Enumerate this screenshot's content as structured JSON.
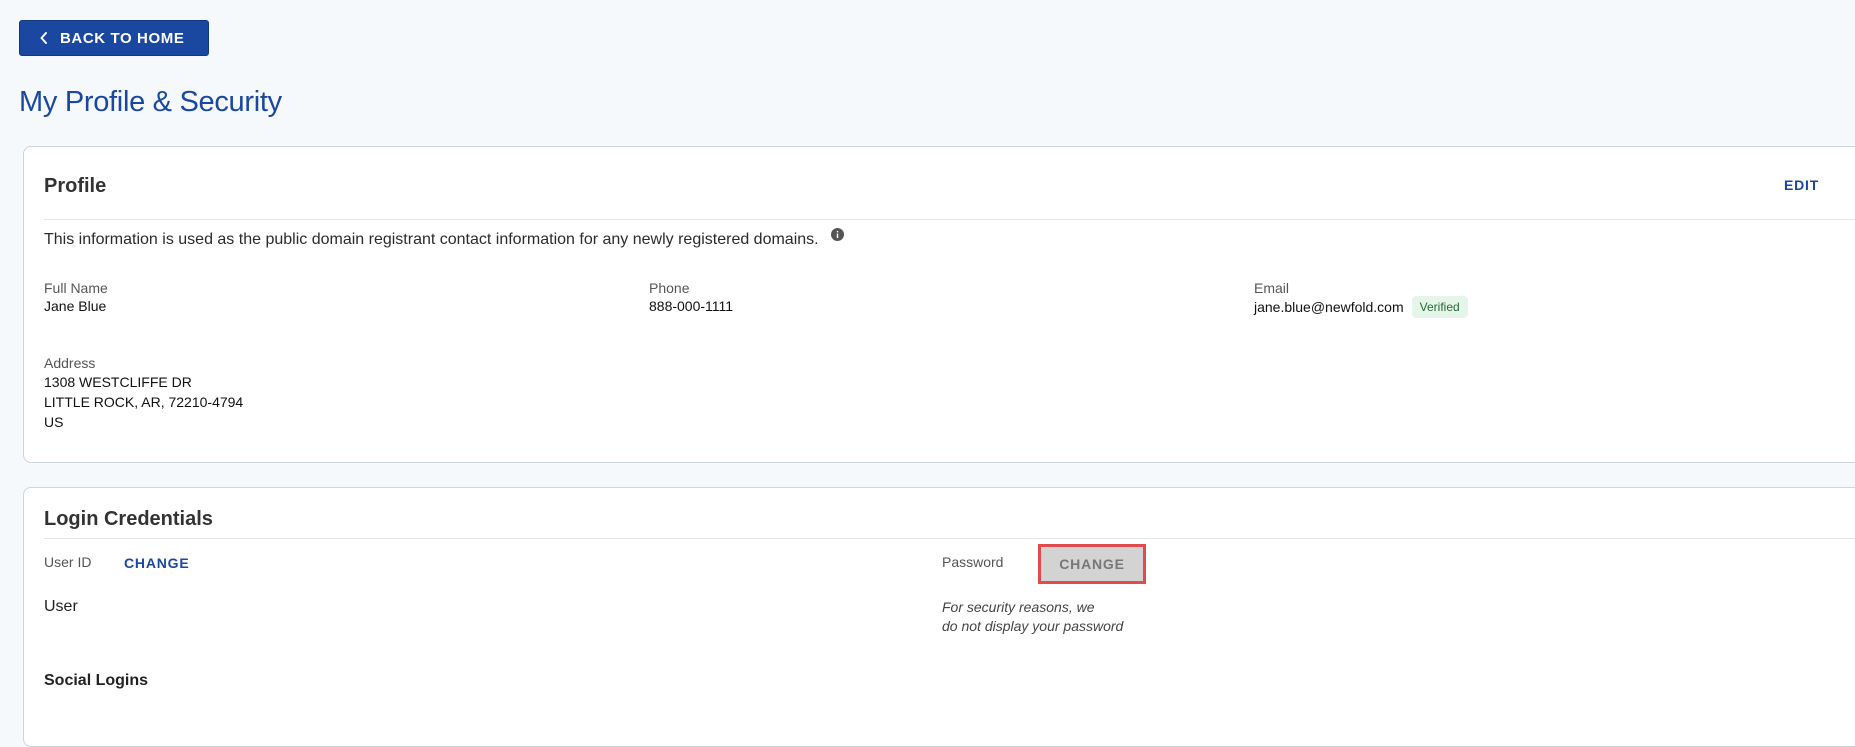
{
  "header": {
    "back_label": "BACK TO HOME",
    "page_title": "My Profile & Security"
  },
  "profile": {
    "title": "Profile",
    "edit_label": "EDIT",
    "info_text": "This information is used as the public domain registrant contact information for any newly registered domains.",
    "full_name_label": "Full Name",
    "full_name": "Jane Blue",
    "phone_label": "Phone",
    "phone": "888-000-1111",
    "email_label": "Email",
    "email": "jane.blue@newfold.com",
    "email_status": "Verified",
    "address_label": "Address",
    "address_line1": "1308 WESTCLIFFE DR",
    "address_line2": "LITTLE ROCK, AR, 72210-4794",
    "address_line3": "US"
  },
  "login": {
    "title": "Login Credentials",
    "user_id_label": "User ID",
    "user_id_change": "CHANGE",
    "user_id_value": "User",
    "password_label": "Password",
    "password_change": "CHANGE",
    "password_note_line1": "For security reasons, we",
    "password_note_line2": "do not display your password",
    "social_logins_label": "Social Logins"
  },
  "colors": {
    "brand": "#1a48a0",
    "background": "#f6f9fc",
    "highlight": "#e04b4b",
    "verified_bg": "#e6f5ea"
  },
  "icons": {
    "back": "chevron-left-icon",
    "info": "info-icon"
  }
}
